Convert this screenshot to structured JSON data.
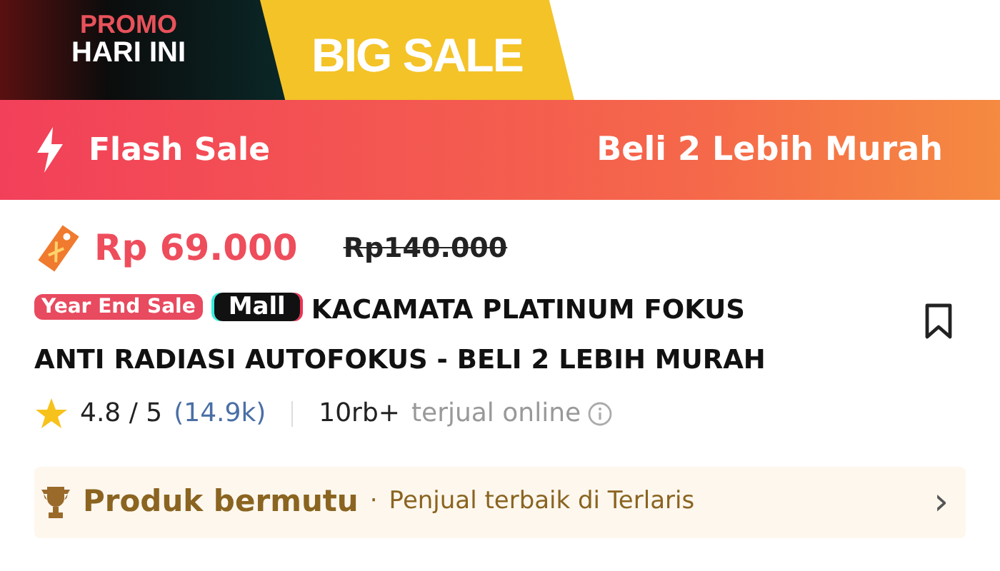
{
  "promo_banner": {
    "line_1": "PROMO",
    "line_2": "HARI INI",
    "tab_label": "BIG SALE"
  },
  "flash_bar": {
    "label": "Flash Sale",
    "offer": "Beli 2 Lebih Murah"
  },
  "product": {
    "price": "Rp 69.000",
    "original_price": "Rp140.000",
    "badges": [
      {
        "label": "Year End Sale",
        "kind": "event"
      },
      {
        "label": "Mall",
        "kind": "mall"
      }
    ],
    "title_lines": [
      "KACAMATA PLATINUM FOKUS",
      "ANTI RADIASI AUTOFOKUS - BELI 2 LEBIH MURAH"
    ],
    "bookmarked": false,
    "rating": "4.8 / 5",
    "review_count": "(14.9k)",
    "sold_count": "10rb+",
    "sold_label": "terjual online"
  },
  "quality_row": {
    "title": "Produk bermutu",
    "separator": "·",
    "subtitle": "Penjual terbaik di Terlaris",
    "chevron": "›"
  }
}
